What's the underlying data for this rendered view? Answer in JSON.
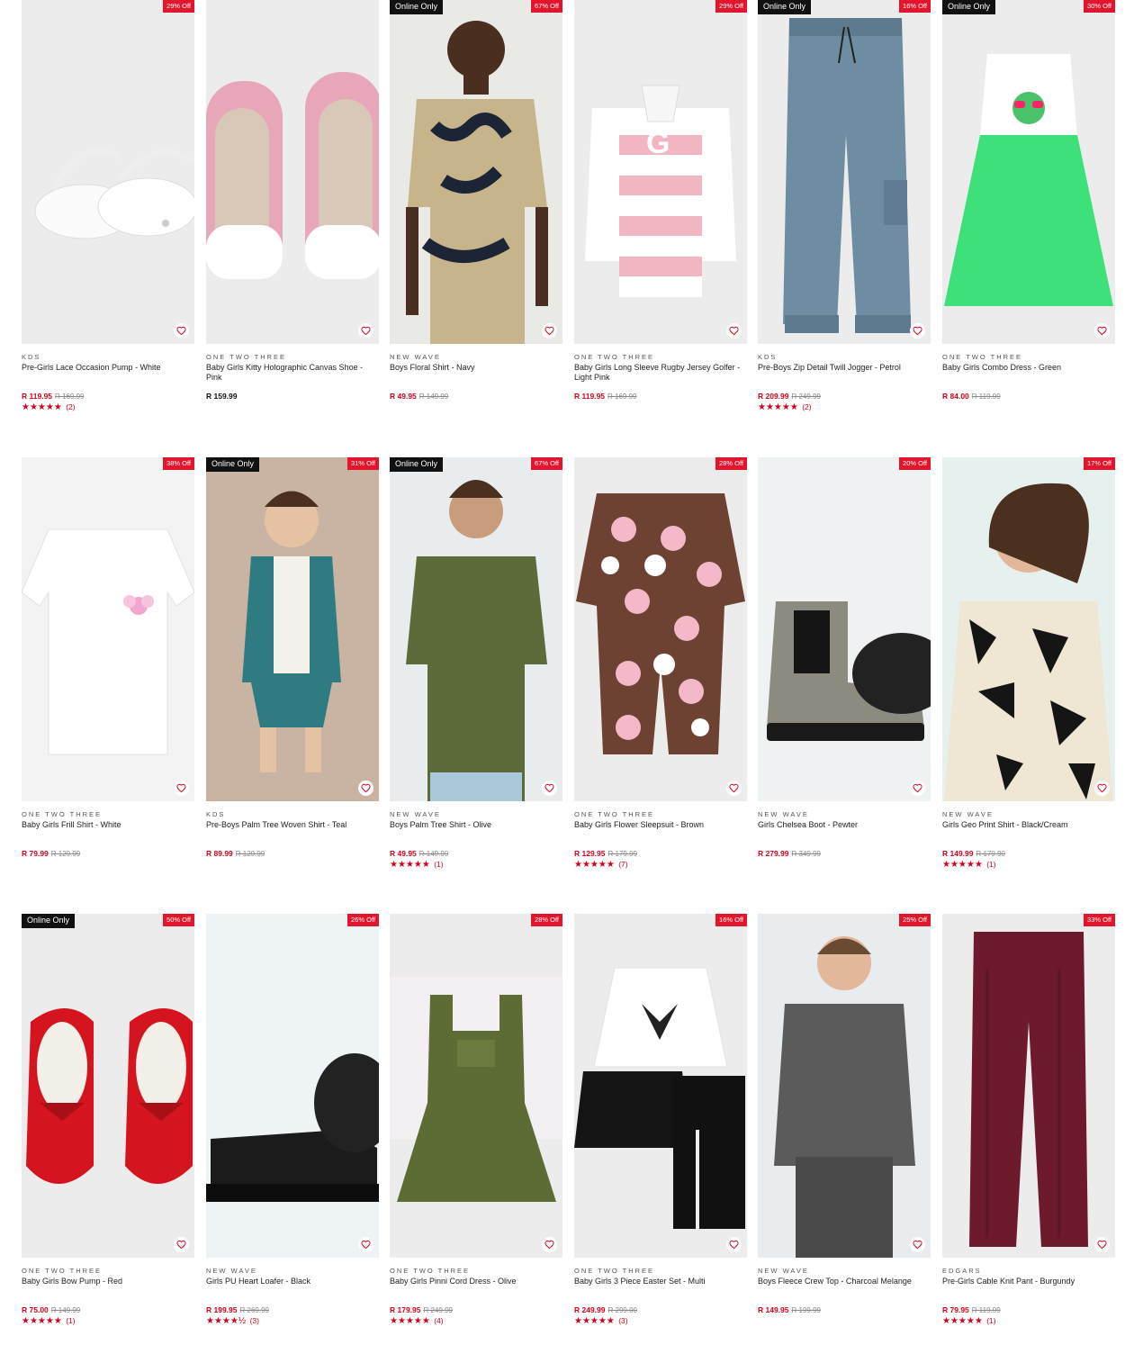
{
  "colors": {
    "accent": "#d6001c",
    "badge": "#e3152c",
    "online_badge": "#111111"
  },
  "products": [
    {
      "brand": "KDS",
      "name": "Pre-Girls Lace Occasion Pump - White",
      "price": "R 119.95",
      "was": "R 169.99",
      "discount": "29% Off",
      "online": "",
      "rating": "★★★★★",
      "reviews": "(2)",
      "bg": "#ececec",
      "icon": "shoe"
    },
    {
      "brand": "ONE TWO THREE",
      "name": "Baby Girls Kitty Holographic Canvas Shoe - Pink",
      "price": "R 159.99",
      "was": "",
      "discount": "",
      "online": "",
      "rating": "",
      "reviews": "",
      "bg": "#ececec",
      "icon": "shoe-pink"
    },
    {
      "brand": "NEW WAVE",
      "name": "Boys Floral Shirt - Navy",
      "price": "R 49.95",
      "was": "R 149.99",
      "discount": "67% Off",
      "online": "Online Only",
      "rating": "",
      "reviews": "",
      "bg": "#e9e9e6",
      "icon": "model-shirt-floral"
    },
    {
      "brand": "ONE TWO THREE",
      "name": "Baby Girls Long Sleeve Rugby Jersey Golfer - Light Pink",
      "price": "R 119.95",
      "was": "R 169.99",
      "discount": "29% Off",
      "online": "",
      "rating": "",
      "reviews": "",
      "bg": "#ececec",
      "icon": "rugby"
    },
    {
      "brand": "KDS",
      "name": "Pre-Boys Zip Detail Twill Jogger - Petrol",
      "price": "R 209.99",
      "was": "R 249.99",
      "discount": "16% Off",
      "online": "Online Only",
      "rating": "★★★★★",
      "reviews": "(2)",
      "bg": "#ececec",
      "icon": "jogger"
    },
    {
      "brand": "ONE TWO THREE",
      "name": "Baby Girls Combo Dress - Green",
      "price": "R 84.00",
      "was": "R 119.99",
      "discount": "30% Off",
      "online": "Online Only",
      "rating": "",
      "reviews": "",
      "bg": "#ececec",
      "icon": "dress-green"
    },
    {
      "brand": "ONE TWO THREE",
      "name": "Baby Girls Frill Shirt - White",
      "price": "R 79.99",
      "was": "R 129.99",
      "discount": "38% Off",
      "online": "",
      "rating": "",
      "reviews": "",
      "bg": "#f3f3f3",
      "icon": "tee-white"
    },
    {
      "brand": "KDS",
      "name": "Pre-Boys Palm Tree Woven Shirt - Teal",
      "price": "R 89.99",
      "was": "R 129.99",
      "discount": "31% Off",
      "online": "Online Only",
      "rating": "",
      "reviews": "",
      "bg": "#c9b4a3",
      "icon": "kid-teal"
    },
    {
      "brand": "NEW WAVE",
      "name": "Boys Palm Tree Shirt - Olive",
      "price": "R 49.95",
      "was": "R 149.99",
      "discount": "67% Off",
      "online": "Online Only",
      "rating": "★★★★★",
      "reviews": "(1)",
      "bg": "#e8ecee",
      "icon": "model-olive"
    },
    {
      "brand": "ONE TWO THREE",
      "name": "Baby Girls Flower Sleepsuit - Brown",
      "price": "R 129.95",
      "was": "R 179.99",
      "discount": "28% Off",
      "online": "",
      "rating": "★★★★★",
      "reviews": "(7)",
      "bg": "#ececec",
      "icon": "sleepsuit"
    },
    {
      "brand": "NEW WAVE",
      "name": "Girls Chelsea Boot - Pewter",
      "price": "R 279.99",
      "was": "R 349.99",
      "discount": "20% Off",
      "online": "",
      "rating": "",
      "reviews": "",
      "bg": "#eef2f2",
      "icon": "boot"
    },
    {
      "brand": "NEW WAVE",
      "name": "Girls Geo Print Shirt - Black/Cream",
      "price": "R 149.99",
      "was": "R 179.99",
      "discount": "17% Off",
      "online": "",
      "rating": "★★★★★",
      "reviews": "(1)",
      "bg": "#e6f0ee",
      "icon": "girl-geo"
    },
    {
      "brand": "ONE TWO THREE",
      "name": "Baby Girls Bow Pump - Red",
      "price": "R 75.00",
      "was": "R 149.99",
      "discount": "50% Off",
      "online": "Online Only",
      "rating": "★★★★★",
      "reviews": "(1)",
      "bg": "#ececec",
      "icon": "shoe-red"
    },
    {
      "brand": "NEW WAVE",
      "name": "Girls PU Heart Loafer - Black",
      "price": "R 199.95",
      "was": "R 269.99",
      "discount": "26% Off",
      "online": "",
      "rating": "★★★★½",
      "reviews": "(3)",
      "bg": "#eef3f5",
      "icon": "loafer"
    },
    {
      "brand": "ONE TWO THREE",
      "name": "Baby Girls Pinni Cord Dress - Olive",
      "price": "R 179.95",
      "was": "R 249.99",
      "discount": "28% Off",
      "online": "",
      "rating": "★★★★★",
      "reviews": "(4)",
      "bg": "#ececec",
      "icon": "pinni"
    },
    {
      "brand": "ONE TWO THREE",
      "name": "Baby Girls 3 Piece Easter Set - Multi",
      "price": "R 249.99",
      "was": "R 299.00",
      "discount": "16% Off",
      "online": "",
      "rating": "★★★★★",
      "reviews": "(3)",
      "bg": "#ececec",
      "icon": "easter-set"
    },
    {
      "brand": "NEW WAVE",
      "name": "Boys Fleece Crew Top - Charcoal Melange",
      "price": "R 149.95",
      "was": "R 199.99",
      "discount": "25% Off",
      "online": "",
      "rating": "",
      "reviews": "",
      "bg": "#e8ecee",
      "icon": "boy-grey"
    },
    {
      "brand": "EDGARS",
      "name": "Pre-Girls Cable Knit Pant - Burgundy",
      "price": "R 79.95",
      "was": "R 119.99",
      "discount": "33% Off",
      "online": "",
      "rating": "★★★★★",
      "reviews": "(1)",
      "bg": "#ececec",
      "icon": "pant-burgundy"
    }
  ]
}
